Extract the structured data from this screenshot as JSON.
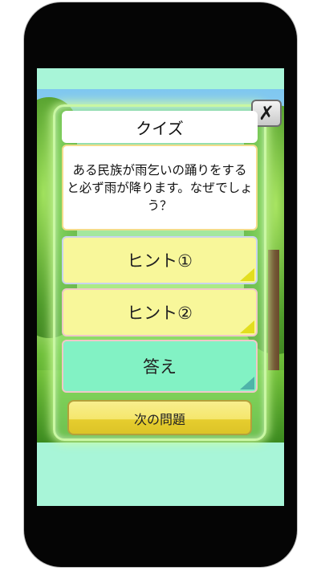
{
  "quiz": {
    "title": "クイズ",
    "question": "ある民族が雨乞いの踊りをすると必ず雨が降ります。なぜでしょう？",
    "hint1_label": "ヒント①",
    "hint2_label": "ヒント②",
    "answer_label": "答え",
    "next_label": "次の問題",
    "close_label": "✗"
  },
  "colors": {
    "screen_bg": "#a8f5d8",
    "hint_card": "#f8f79a",
    "answer_card": "#82f2c4",
    "next_button": "#f5e66c"
  },
  "icons": {
    "close": "close-icon",
    "fold_corner": "page-fold-icon"
  }
}
